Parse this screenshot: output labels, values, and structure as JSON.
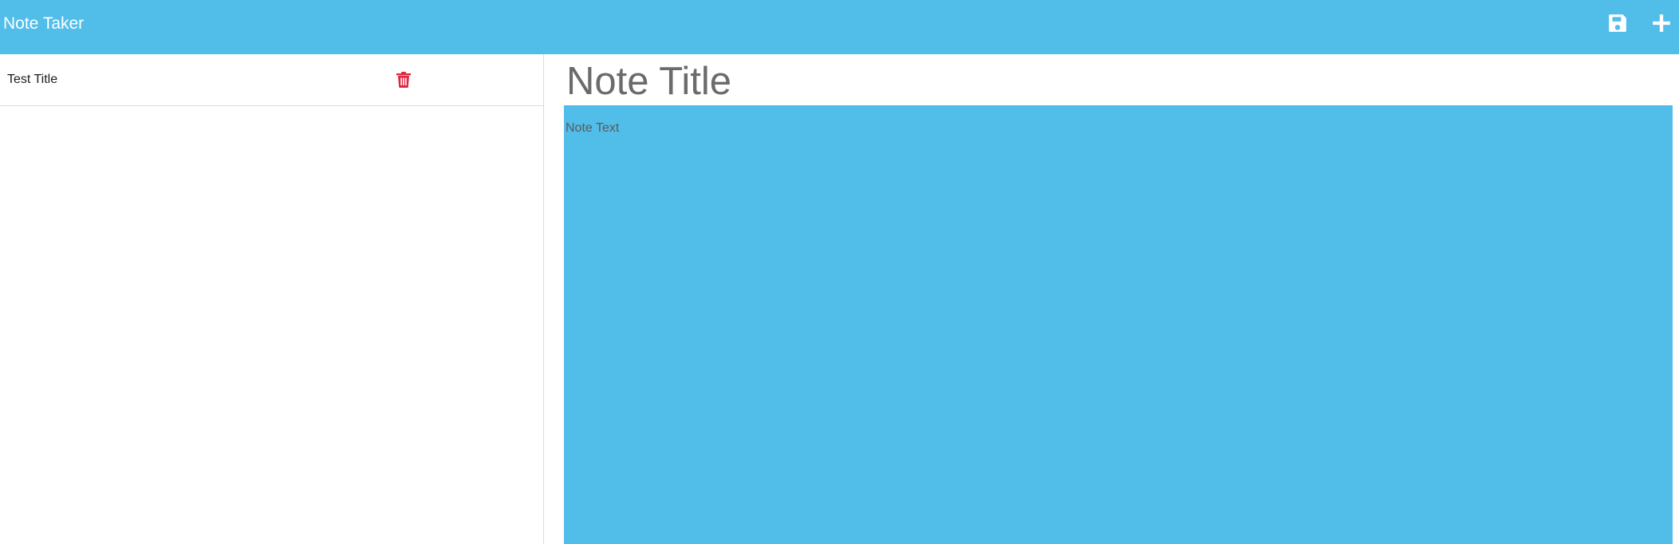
{
  "app": {
    "brand": "Note Taker"
  },
  "toolbar": {
    "save_icon": "floppy-disk-icon",
    "new_icon": "plus-icon"
  },
  "sidebar": {
    "notes": [
      {
        "title": "Test Title",
        "delete_icon": "trash-icon"
      }
    ]
  },
  "editor": {
    "title_placeholder": "Note Title",
    "text_placeholder": "Note Text"
  },
  "colors": {
    "navbar": "#51bde9",
    "editor_background": "#51bde9",
    "delete_icon": "#e0263f",
    "title_text": "#6b6b6b"
  }
}
